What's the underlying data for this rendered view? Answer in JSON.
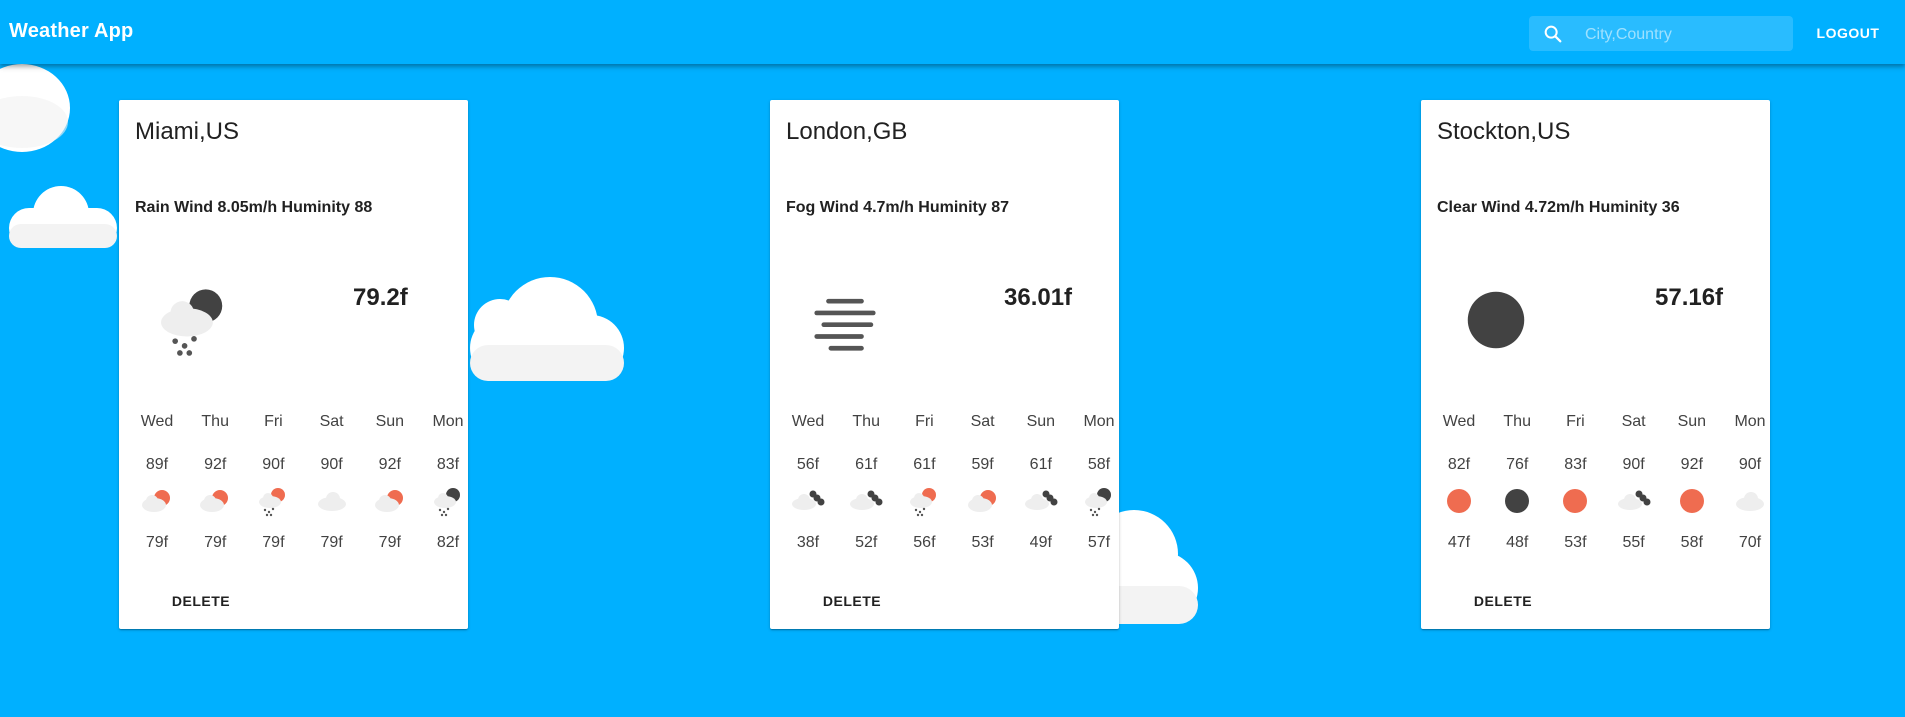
{
  "app": {
    "title": "Weather App"
  },
  "search": {
    "placeholder": "City,Country",
    "value": ""
  },
  "header": {
    "logout_label": "LOGOUT"
  },
  "colors": {
    "background": "#00b0ff",
    "sun": "#ef6c50",
    "dark": "#424242",
    "cloud": "#eeeeee"
  },
  "cards": [
    {
      "title": "Miami,US",
      "summary": "Rain Wind 8.05m/h Huminity 88",
      "temp": "79.2f",
      "icon": "rain-night-icon",
      "delete_label": "DELETE",
      "forecast": [
        {
          "day": "Wed",
          "high": "89f",
          "low": "79f",
          "icon": "partly-cloudy-day-icon"
        },
        {
          "day": "Thu",
          "high": "92f",
          "low": "79f",
          "icon": "partly-cloudy-day-icon"
        },
        {
          "day": "Fri",
          "high": "90f",
          "low": "79f",
          "icon": "rain-day-icon"
        },
        {
          "day": "Sat",
          "high": "90f",
          "low": "79f",
          "icon": "cloudy-icon"
        },
        {
          "day": "Sun",
          "high": "92f",
          "low": "79f",
          "icon": "partly-cloudy-day-icon"
        },
        {
          "day": "Mon",
          "high": "83f",
          "low": "82f",
          "icon": "rain-night-icon"
        }
      ]
    },
    {
      "title": "London,GB",
      "summary": "Fog Wind 4.7m/h Huminity 87",
      "temp": "36.01f",
      "icon": "fog-icon",
      "delete_label": "DELETE",
      "forecast": [
        {
          "day": "Wed",
          "high": "56f",
          "low": "38f",
          "icon": "cloudy-wind-icon"
        },
        {
          "day": "Thu",
          "high": "61f",
          "low": "52f",
          "icon": "cloudy-wind-icon"
        },
        {
          "day": "Fri",
          "high": "61f",
          "low": "56f",
          "icon": "rain-day-icon"
        },
        {
          "day": "Sat",
          "high": "59f",
          "low": "53f",
          "icon": "partly-cloudy-day-icon"
        },
        {
          "day": "Sun",
          "high": "61f",
          "low": "49f",
          "icon": "cloudy-wind-icon"
        },
        {
          "day": "Mon",
          "high": "58f",
          "low": "57f",
          "icon": "rain-night-icon"
        }
      ]
    },
    {
      "title": "Stockton,US",
      "summary": "Clear Wind 4.72m/h Huminity 36",
      "temp": "57.16f",
      "icon": "clear-night-icon",
      "delete_label": "DELETE",
      "forecast": [
        {
          "day": "Wed",
          "high": "82f",
          "low": "47f",
          "icon": "clear-day-icon"
        },
        {
          "day": "Thu",
          "high": "76f",
          "low": "48f",
          "icon": "clear-night-icon"
        },
        {
          "day": "Fri",
          "high": "83f",
          "low": "53f",
          "icon": "clear-day-icon"
        },
        {
          "day": "Sat",
          "high": "90f",
          "low": "55f",
          "icon": "cloudy-wind-icon"
        },
        {
          "day": "Sun",
          "high": "92f",
          "low": "58f",
          "icon": "clear-day-icon"
        },
        {
          "day": "Mon",
          "high": "90f",
          "low": "70f",
          "icon": "cloudy-icon"
        }
      ]
    }
  ]
}
